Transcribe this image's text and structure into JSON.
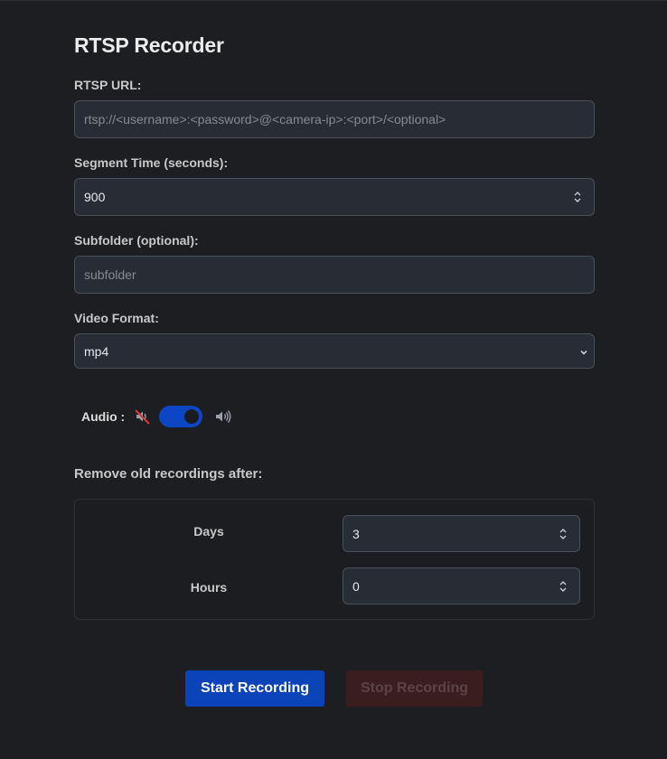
{
  "title": "RTSP Recorder",
  "rtsp_url": {
    "label": "RTSP URL:",
    "value": "",
    "placeholder": "rtsp://<username>:<password>@<camera-ip>:<port>/<optional>"
  },
  "segment_time": {
    "label": "Segment Time (seconds):",
    "value": "900"
  },
  "subfolder": {
    "label": "Subfolder (optional):",
    "value": "",
    "placeholder": "subfolder"
  },
  "video_format": {
    "label": "Video Format:",
    "selected": "mp4"
  },
  "audio": {
    "label": "Audio :",
    "enabled": true,
    "icons": [
      "muted-speaker-icon",
      "speaker-icon"
    ]
  },
  "retention": {
    "heading": "Remove old recordings after:",
    "days_label": "Days",
    "days_value": "3",
    "hours_label": "Hours",
    "hours_value": "0"
  },
  "buttons": {
    "start": "Start Recording",
    "stop": "Stop Recording",
    "stop_disabled": true
  },
  "colors": {
    "background": "#1d1e21",
    "input_bg": "#272c35",
    "accent_blue": "#0b44b8",
    "stop_disabled_bg": "#3a1d1f"
  }
}
